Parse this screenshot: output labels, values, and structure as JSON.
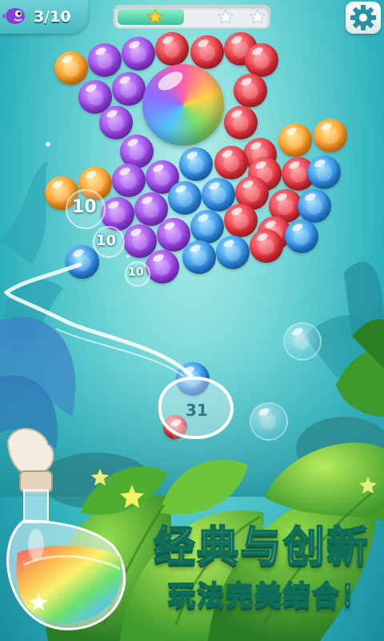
{
  "hud": {
    "moves_text": "3/10",
    "progress_fraction": 0.45,
    "stars_total": 3,
    "stars_earned": 1
  },
  "board": {
    "score_popups": [
      "10",
      "10",
      "10"
    ],
    "shooter_count": "31",
    "special_bubble": "rainbow-swirl"
  },
  "slogan": {
    "line1": "经典与创新",
    "line2": "玩法完美结合！"
  },
  "colors": {
    "purple": "#9a43e8",
    "red": "#e7323d",
    "blue": "#2e8ee8",
    "orange": "#ff9a22",
    "accent": "#37c39a",
    "slogan_stroke": "#0e6e57"
  },
  "icons": {
    "moves": "fish-icon",
    "settings": "gear-icon",
    "stars": "star-icon"
  }
}
